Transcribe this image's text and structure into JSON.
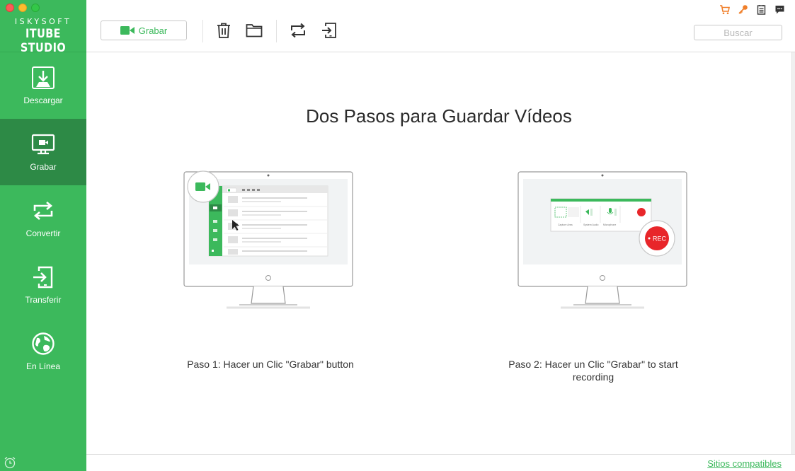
{
  "brand": {
    "top": "ISKYSOFT",
    "main": "ITUBE STUDIO"
  },
  "sidebar": {
    "items": [
      {
        "label": "Descargar",
        "icon": "download-icon",
        "active": false
      },
      {
        "label": "Grabar",
        "icon": "screen-record-icon",
        "active": true
      },
      {
        "label": "Convertir",
        "icon": "convert-icon",
        "active": false
      },
      {
        "label": "Transferir",
        "icon": "transfer-icon",
        "active": false
      },
      {
        "label": "En Línea",
        "icon": "globe-icon",
        "active": false
      }
    ]
  },
  "toolbar": {
    "record_label": "Grabar",
    "search_placeholder": "Buscar",
    "icons": [
      "trash-icon",
      "folder-icon",
      "convert-icon",
      "transfer-icon"
    ],
    "top_icons": [
      "cart-icon",
      "key-icon",
      "notes-icon",
      "chat-icon"
    ]
  },
  "main": {
    "title": "Dos Pasos para Guardar Vídeos",
    "steps": [
      {
        "label": "Paso 1: Hacer un Clic \"Grabar\" button"
      },
      {
        "label": "Paso 2: Hacer un Clic  \"Grabar\" to start recording"
      }
    ],
    "illustration": {
      "rec_label": "REC",
      "capture_items": [
        "Capture Area",
        "System Audio",
        "Microphone",
        "REC"
      ]
    }
  },
  "footer": {
    "link": "Sitios compatibles"
  },
  "colors": {
    "brand_green": "#3cb95c",
    "active_green": "#2d8a46",
    "rec_red": "#e8262a"
  }
}
